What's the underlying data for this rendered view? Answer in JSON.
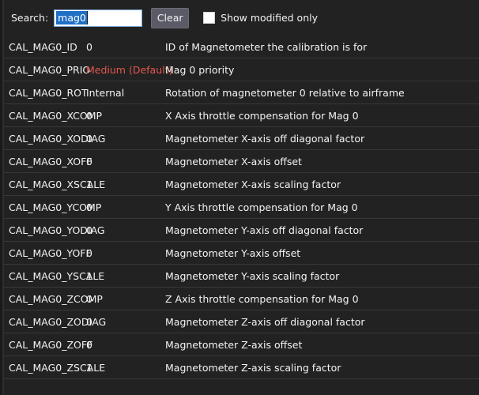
{
  "toolbar": {
    "search_label": "Search:",
    "search_value": "mag0",
    "search_placeholder": "",
    "clear_label": "Clear",
    "show_modified_label": "Show modified only",
    "show_modified_checked": false
  },
  "colors": {
    "background": "#222222",
    "row_separator": "#383838",
    "text": "#f3f3f3",
    "modified_value": "#e2584f",
    "button": "#5b5b68",
    "selection": "#1f6fc4",
    "input_border": "#7aa9d6"
  },
  "table": {
    "rows": [
      {
        "name": "CAL_MAG0_ID",
        "value": "0",
        "modified": false,
        "description": "ID of Magnetometer the calibration is for"
      },
      {
        "name": "CAL_MAG0_PRIO",
        "value": "Medium (Default)",
        "modified": true,
        "description": "Mag 0 priority"
      },
      {
        "name": "CAL_MAG0_ROT",
        "value": "Internal",
        "modified": false,
        "description": "Rotation of magnetometer 0 relative to airframe"
      },
      {
        "name": "CAL_MAG0_XCOMP",
        "value": "0",
        "modified": false,
        "description": "X Axis throttle compensation for Mag 0"
      },
      {
        "name": "CAL_MAG0_XODIAG",
        "value": "0",
        "modified": false,
        "description": "Magnetometer X-axis off diagonal factor"
      },
      {
        "name": "CAL_MAG0_XOFF",
        "value": "0",
        "modified": false,
        "description": "Magnetometer X-axis offset"
      },
      {
        "name": "CAL_MAG0_XSCALE",
        "value": "1",
        "modified": false,
        "description": "Magnetometer X-axis scaling factor"
      },
      {
        "name": "CAL_MAG0_YCOMP",
        "value": "0",
        "modified": false,
        "description": "Y Axis throttle compensation for Mag 0"
      },
      {
        "name": "CAL_MAG0_YODIAG",
        "value": "0",
        "modified": false,
        "description": "Magnetometer Y-axis off diagonal factor"
      },
      {
        "name": "CAL_MAG0_YOFF",
        "value": "0",
        "modified": false,
        "description": "Magnetometer Y-axis offset"
      },
      {
        "name": "CAL_MAG0_YSCALE",
        "value": "1",
        "modified": false,
        "description": "Magnetometer Y-axis scaling factor"
      },
      {
        "name": "CAL_MAG0_ZCOMP",
        "value": "0",
        "modified": false,
        "description": "Z Axis throttle compensation for Mag 0"
      },
      {
        "name": "CAL_MAG0_ZODIAG",
        "value": "0",
        "modified": false,
        "description": "Magnetometer Z-axis off diagonal factor"
      },
      {
        "name": "CAL_MAG0_ZOFF",
        "value": "0",
        "modified": false,
        "description": "Magnetometer Z-axis offset"
      },
      {
        "name": "CAL_MAG0_ZSCALE",
        "value": "1",
        "modified": false,
        "description": "Magnetometer Z-axis scaling factor"
      }
    ]
  }
}
